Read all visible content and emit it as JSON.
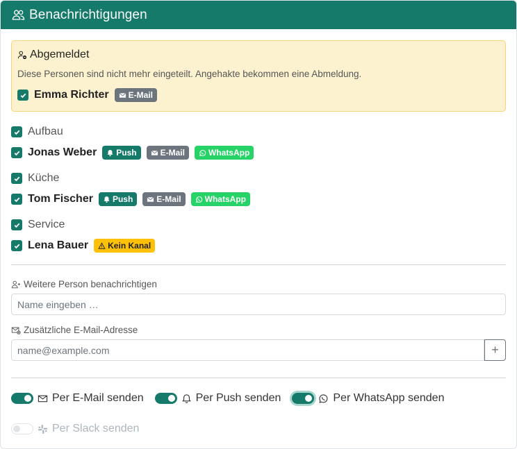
{
  "header": {
    "title": "Benachrichtigungen",
    "icon": "people-icon"
  },
  "unsubscribed": {
    "title": "Abgemeldet",
    "description": "Diese Personen sind nicht mehr eingeteilt. Angehakte bekommen eine Abmeldung.",
    "person": {
      "name": "Emma Richter",
      "checked": true,
      "badges": [
        "E-Mail"
      ]
    }
  },
  "groups": [
    {
      "label": "Aufbau",
      "checked": true,
      "person": {
        "name": "Jonas Weber",
        "checked": true,
        "badges": {
          "push": "Push",
          "mail": "E-Mail",
          "whatsapp": "WhatsApp"
        }
      }
    },
    {
      "label": "Küche",
      "checked": true,
      "person": {
        "name": "Tom Fischer",
        "checked": true,
        "badges": {
          "push": "Push",
          "mail": "E-Mail",
          "whatsapp": "WhatsApp"
        }
      }
    },
    {
      "label": "Service",
      "checked": true,
      "person": {
        "name": "Lena Bauer",
        "checked": true,
        "badges": {
          "warning": "Kein Kanal"
        }
      }
    }
  ],
  "add_person": {
    "label": "Weitere Person benachrichtigen",
    "placeholder": "Name eingeben …"
  },
  "extra_email": {
    "label": "Zusätzliche E-Mail-Adresse",
    "placeholder": "name@example.com",
    "add_button": "+"
  },
  "channels": [
    {
      "label": "Per E-Mail senden",
      "enabled": true
    },
    {
      "label": "Per Push senden",
      "enabled": true
    },
    {
      "label": "Per WhatsApp senden",
      "enabled": true
    },
    {
      "label": "Per Slack senden",
      "enabled": false,
      "disabled": true
    }
  ],
  "colors": {
    "primary": "#167a6a",
    "mail_badge": "#6c757d",
    "whatsapp_badge": "#25d366",
    "warning_badge": "#ffc107",
    "alert_bg": "#fdf2cf"
  }
}
